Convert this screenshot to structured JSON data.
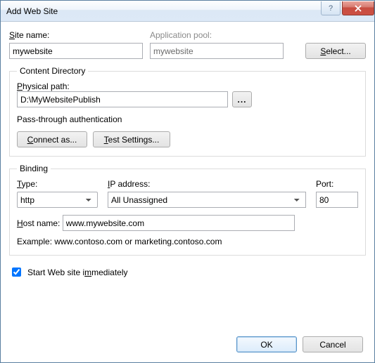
{
  "window": {
    "title": "Add Web Site"
  },
  "labels": {
    "site_name": "ite name:",
    "site_name_u": "S",
    "app_pool": "Application pool:",
    "select_btn": "elect...",
    "select_btn_u": "S",
    "content_dir": "Content Directory",
    "physical_path": "hysical path:",
    "physical_path_u": "P",
    "browse": "...",
    "passthrough": "Pass-through authentication",
    "connect_as": "onnect as...",
    "connect_as_u": "C",
    "test_settings": "est Settings...",
    "test_settings_u": "T",
    "binding": "Binding",
    "type": "ype:",
    "type_u": "T",
    "ip": "P address:",
    "ip_u": "I",
    "port": "Port:",
    "host": "ost name:",
    "host_u": "H",
    "example": "Example: www.contoso.com or marketing.contoso.com",
    "start_pre": "Start Web site i",
    "start_u": "m",
    "start_post": "mediately",
    "ok": "OK",
    "cancel": "Cancel"
  },
  "values": {
    "site_name": "mywebsite",
    "app_pool": "mywebsite",
    "physical_path": "D:\\MyWebsitePublish",
    "type": "http",
    "ip": "All Unassigned",
    "port": "80",
    "host": "www.mywebsite.com",
    "start_immediately": true
  }
}
